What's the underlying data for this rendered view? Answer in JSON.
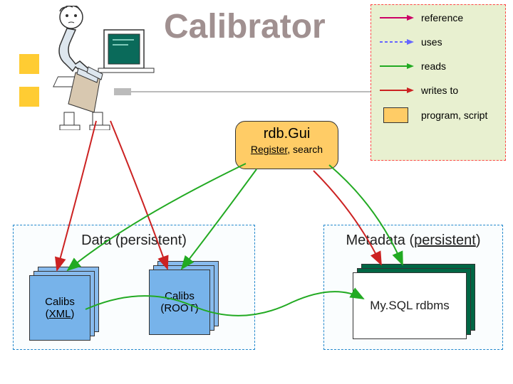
{
  "title": "Calibrator",
  "legend": {
    "items": [
      {
        "label": "reference",
        "color": "#cc0066"
      },
      {
        "label": "uses",
        "color": "#6666ff"
      },
      {
        "label": "reads",
        "color": "#22aa22"
      },
      {
        "label": "writes to",
        "color": "#cc2222"
      }
    ],
    "program_label": "program, script"
  },
  "gui": {
    "title": "rdb.Gui",
    "subtitle_register": "Register",
    "subtitle_search": "search"
  },
  "data_panel": {
    "title": "Data (persistent)",
    "calibs_xml_line1": "Calibs",
    "calibs_xml_line2_open": "(",
    "calibs_xml_line2_link": "XML",
    "calibs_xml_line2_close": ")",
    "calibs_root_line1": "Calibs",
    "calibs_root_line2": "(ROOT)"
  },
  "meta_panel": {
    "title_prefix": "Metadata (",
    "title_link": "persistent",
    "title_suffix": ")",
    "db_label": "My.SQL rdbms"
  }
}
